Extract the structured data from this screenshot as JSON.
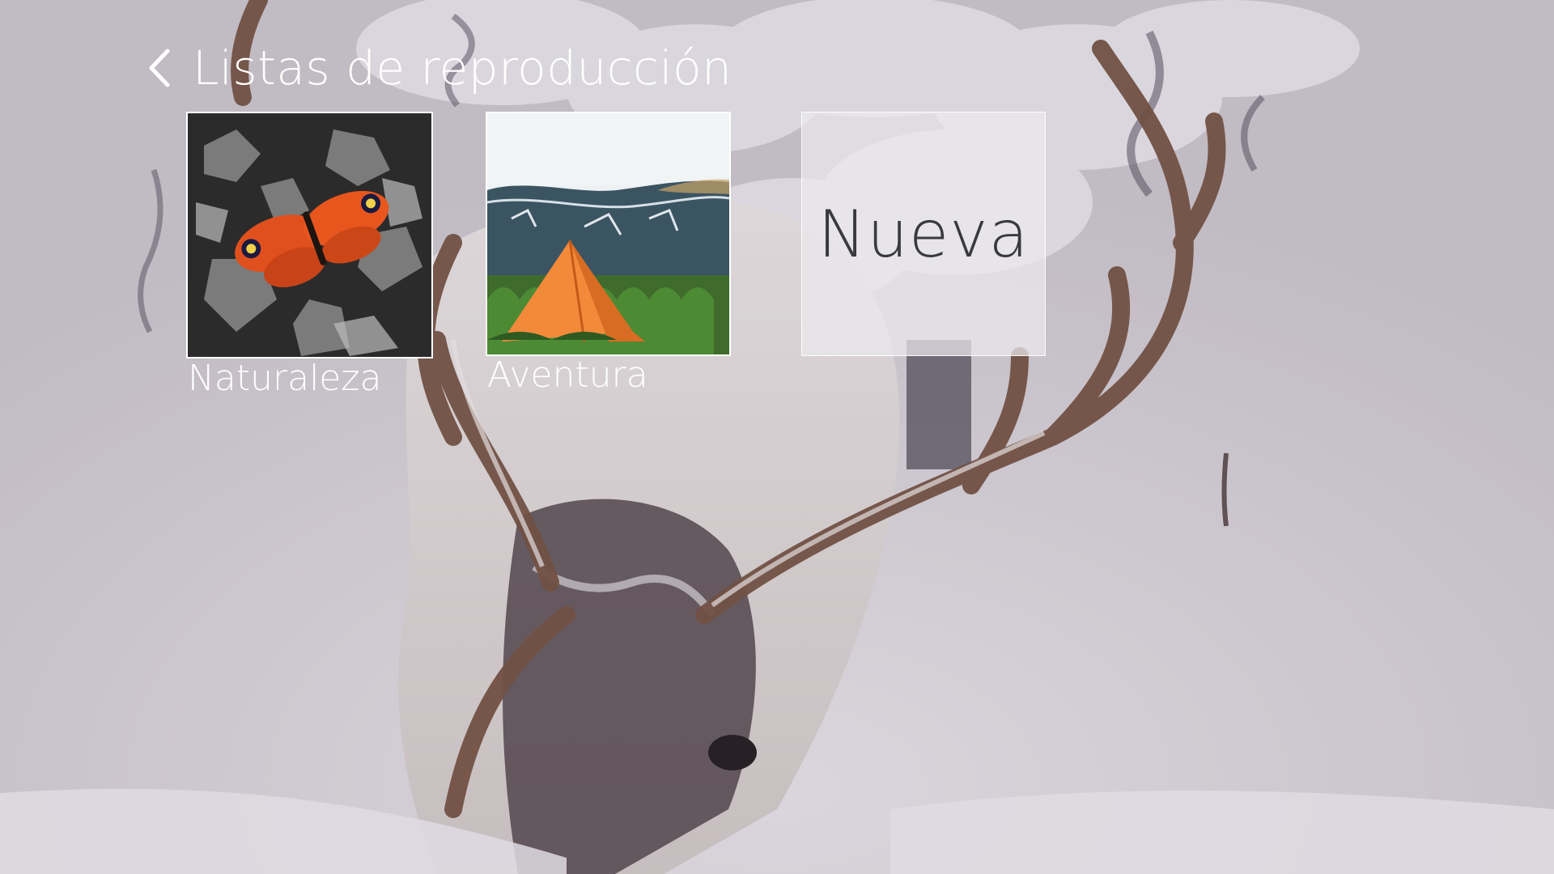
{
  "header": {
    "title": "Listas de reproducción",
    "back_icon": "chevron-left-icon"
  },
  "playlists": [
    {
      "label": "Naturaleza",
      "thumbnail": "butterfly-on-leaves"
    },
    {
      "label": "Aventura",
      "thumbnail": "orange-tent-mountains"
    }
  ],
  "new_tile": {
    "label": "Nueva"
  },
  "background": {
    "subject": "reindeer-in-snow"
  },
  "colors": {
    "text": "#ffffff",
    "tile_overlay": "#eceaee",
    "new_label": "#3a3a3e",
    "tent": "#f28a3a"
  }
}
